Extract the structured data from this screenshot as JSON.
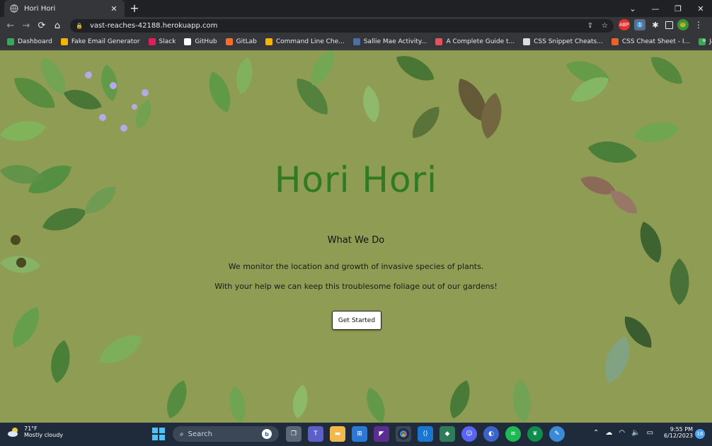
{
  "browser": {
    "tab": {
      "title": "Hori Hori",
      "close": "✕"
    },
    "new_tab": "+",
    "window_controls": {
      "chevron": "⌄",
      "minimize": "—",
      "restore": "❐",
      "close": "✕"
    },
    "nav": {
      "back": "←",
      "forward": "→",
      "reload": "⟳",
      "home": "⌂"
    },
    "url": "vast-reaches-42188.herokuapp.com",
    "omnibox_icons": {
      "share": "⇪",
      "bookmark_star": "☆"
    },
    "extensions": [
      "ABP",
      "1",
      "puzzle",
      "sidebar",
      "frog",
      "menu"
    ]
  },
  "bookmarks": {
    "items": [
      {
        "label": "Dashboard",
        "icon_color": "#3aa757"
      },
      {
        "label": "Fake Email Generator",
        "icon_color": "#f4b400"
      },
      {
        "label": "Slack",
        "icon_color": "#e01e5a"
      },
      {
        "label": "GitHub",
        "icon_color": "#ffffff"
      },
      {
        "label": "GitLab",
        "icon_color": "#fc6d26"
      },
      {
        "label": "Command Line Che...",
        "icon_color": "#f4b400"
      },
      {
        "label": "Sallie Mae Activity...",
        "icon_color": "#4a6fa5"
      },
      {
        "label": "A Complete Guide t...",
        "icon_color": "#e8505b"
      },
      {
        "label": "CSS Snippet Cheats...",
        "icon_color": "#dddddd"
      },
      {
        "label": "CSS Cheat Sheet - I...",
        "icon_color": "#e8622a"
      },
      {
        "label": "JavaScript Operators",
        "icon_color": "#3aa757"
      }
    ],
    "more": "»"
  },
  "page": {
    "title": "Hori Hori",
    "section_heading": "What We Do",
    "paragraph_1": "We monitor the location and growth of invasive species of plants.",
    "paragraph_2": "With your help we can keep this troublesome foliage out of our gardens!",
    "cta_label": "Get Started",
    "background_color": "#8f9c54",
    "title_color": "#2f7a22"
  },
  "taskbar": {
    "weather": {
      "temp": "71°F",
      "condition": "Mostly cloudy"
    },
    "search_label": "Search",
    "apps": [
      "task-view",
      "teams",
      "file-explorer",
      "store",
      "visual-studio",
      "chrome",
      "vscode",
      "sourcetree",
      "discord",
      "browser-blue",
      "spotify",
      "mongodb",
      "paint"
    ],
    "tray": [
      "chevron-up",
      "cloud",
      "wifi",
      "volume",
      "battery"
    ],
    "time": "9:55 PM",
    "date": "6/12/2023",
    "notification_count": "16"
  }
}
